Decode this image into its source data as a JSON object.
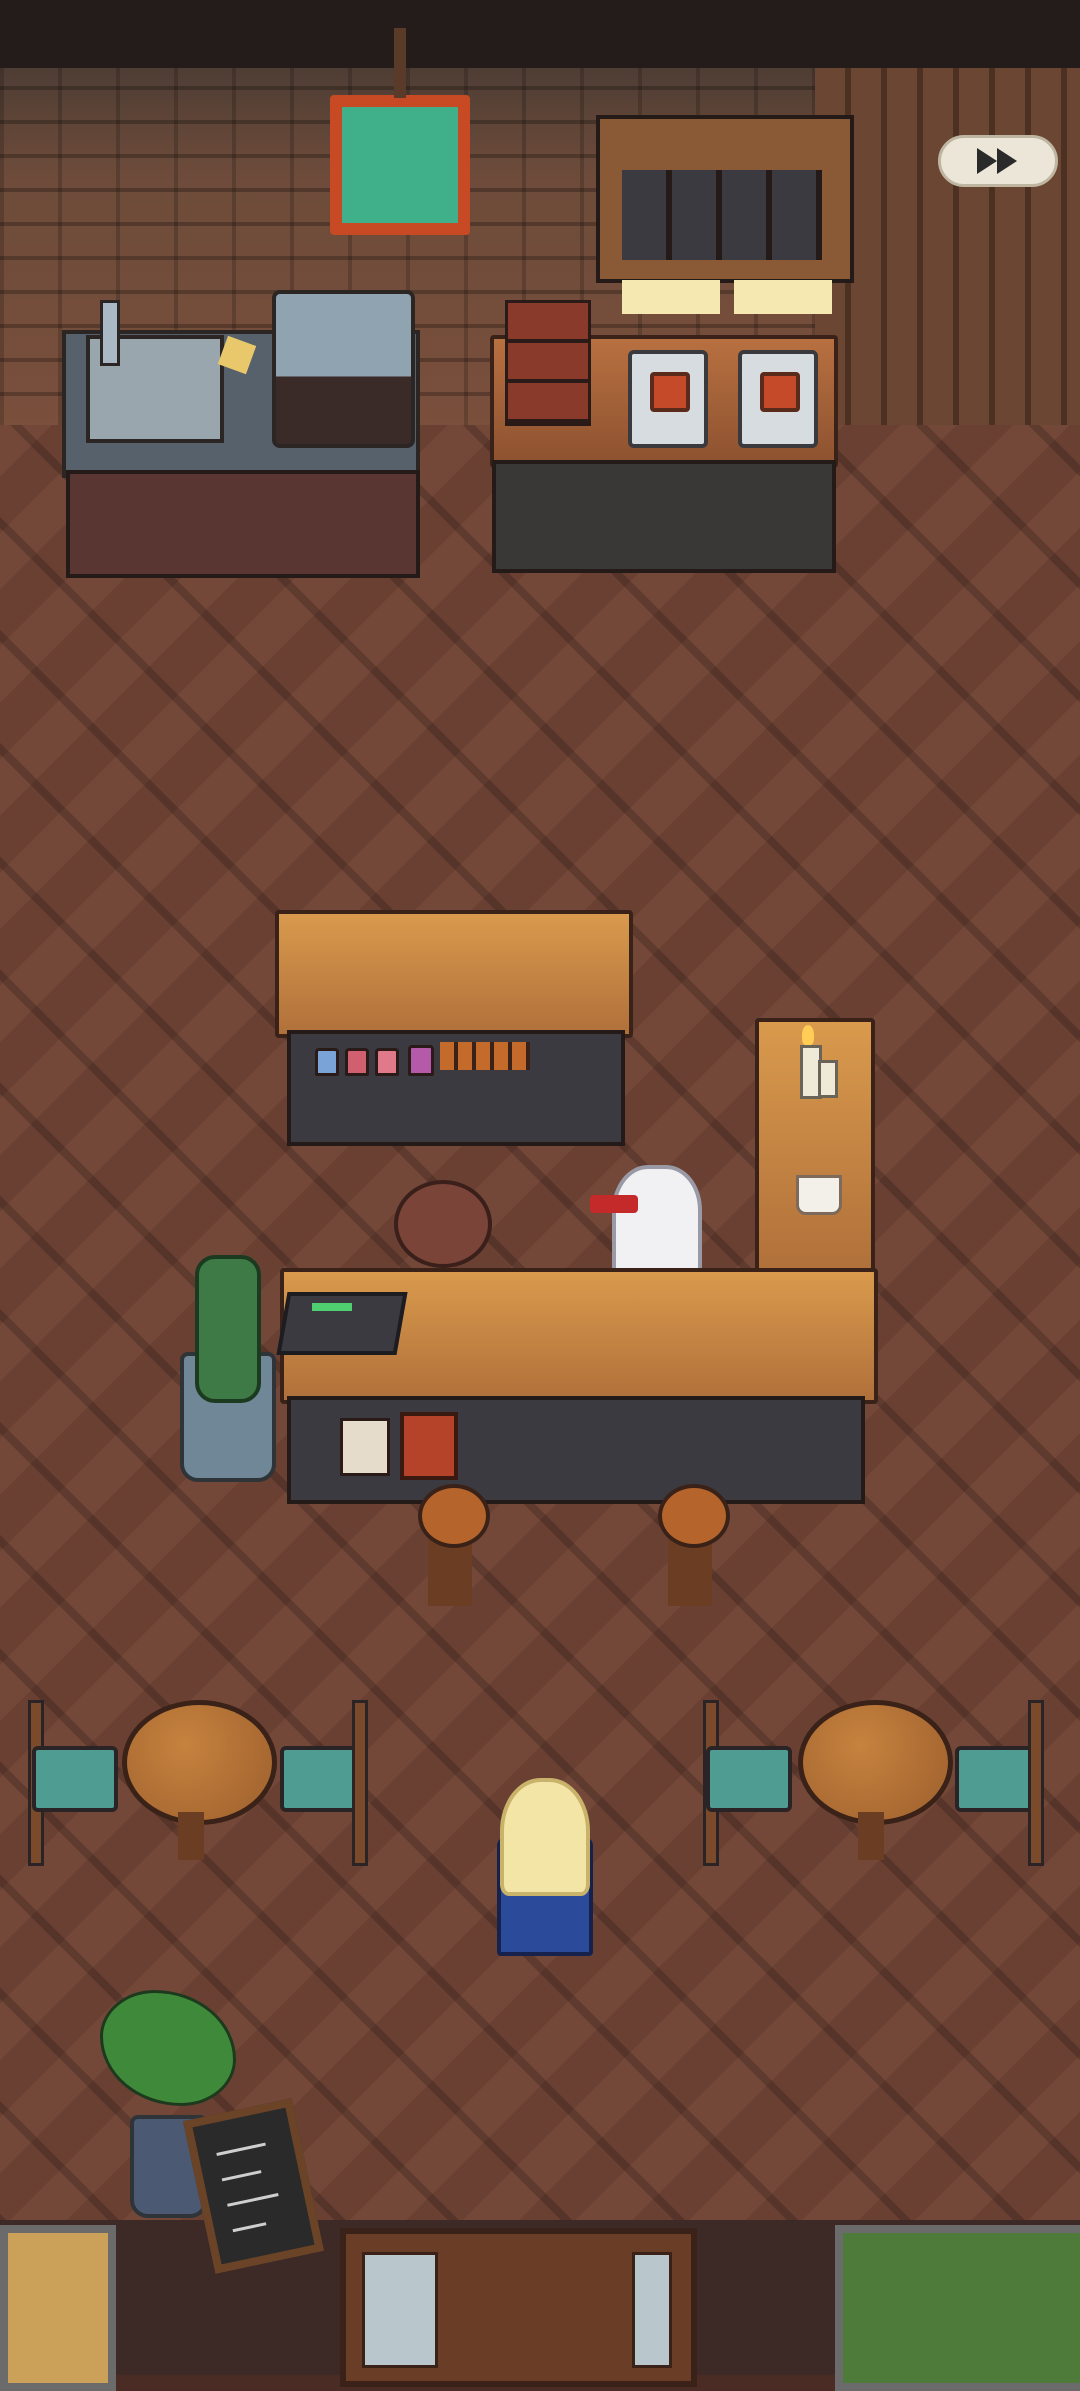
{
  "game": {
    "scene_name": "cafe-interior",
    "controls": {
      "skip_button": {
        "icon": "fast-forward-icon",
        "color": "#ece6d8"
      }
    }
  },
  "colors": {
    "floor": "#6a4032",
    "counter_wood": "#d99a4d",
    "monitor_screen": "#3fb08a",
    "accent_red": "#c74a24",
    "chair_cushion": "#4f9c93"
  }
}
